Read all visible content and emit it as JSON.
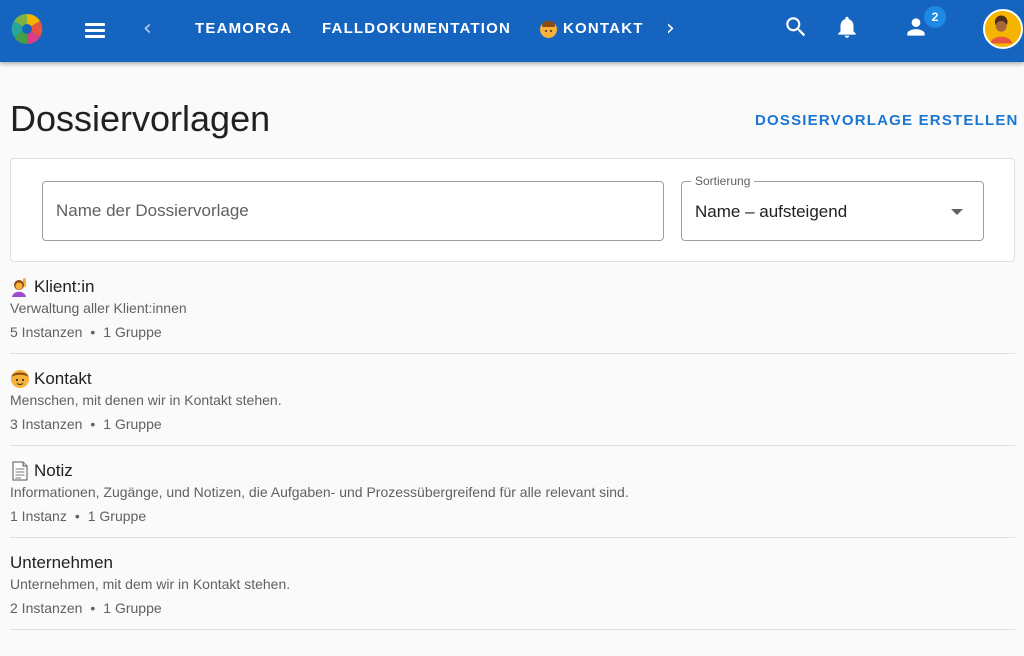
{
  "appbar": {
    "tabs": [
      {
        "label": "TEAMORGA"
      },
      {
        "label": "FALLDOKUMENTATION"
      },
      {
        "label": "KONTAKT",
        "icon": "contact-person-emoji"
      }
    ],
    "notification_count": "2",
    "accent_color": "#1565c0",
    "icons": [
      "app-logo",
      "menu-icon",
      "chevron-left-icon",
      "chevron-right-icon",
      "search-icon",
      "bell-icon",
      "people-icon",
      "avatar"
    ]
  },
  "header": {
    "title": "Dossiervorlagen",
    "create_label": "DOSSIERVORLAGE ERSTELLEN",
    "create_color": "#1976d2"
  },
  "filters": {
    "search_placeholder": "Name der Dossiervorlage",
    "search_value": "",
    "sort_label": "Sortierung",
    "sort_value": "Name – aufsteigend"
  },
  "templates": [
    {
      "name": "Klient:in",
      "icon": "person-raising-hand-emoji",
      "description": "Verwaltung aller Klient:innen",
      "instances": "5 Instanzen",
      "groups": "1 Gruppe"
    },
    {
      "name": "Kontakt",
      "icon": "person-face-emoji",
      "description": "Menschen, mit denen wir in Kontakt stehen.",
      "instances": "3 Instanzen",
      "groups": "1 Gruppe"
    },
    {
      "name": "Notiz",
      "icon": "document-emoji",
      "description": "Informationen, Zugänge, und Notizen, die Aufgaben- und Prozessübergreifend für alle relevant sind.",
      "instances": "1 Instanz",
      "groups": "1 Gruppe"
    },
    {
      "name": "Unternehmen",
      "icon": "",
      "description": "Unternehmen, mit dem wir in Kontakt stehen.",
      "instances": "2 Instanzen",
      "groups": "1 Gruppe"
    }
  ]
}
